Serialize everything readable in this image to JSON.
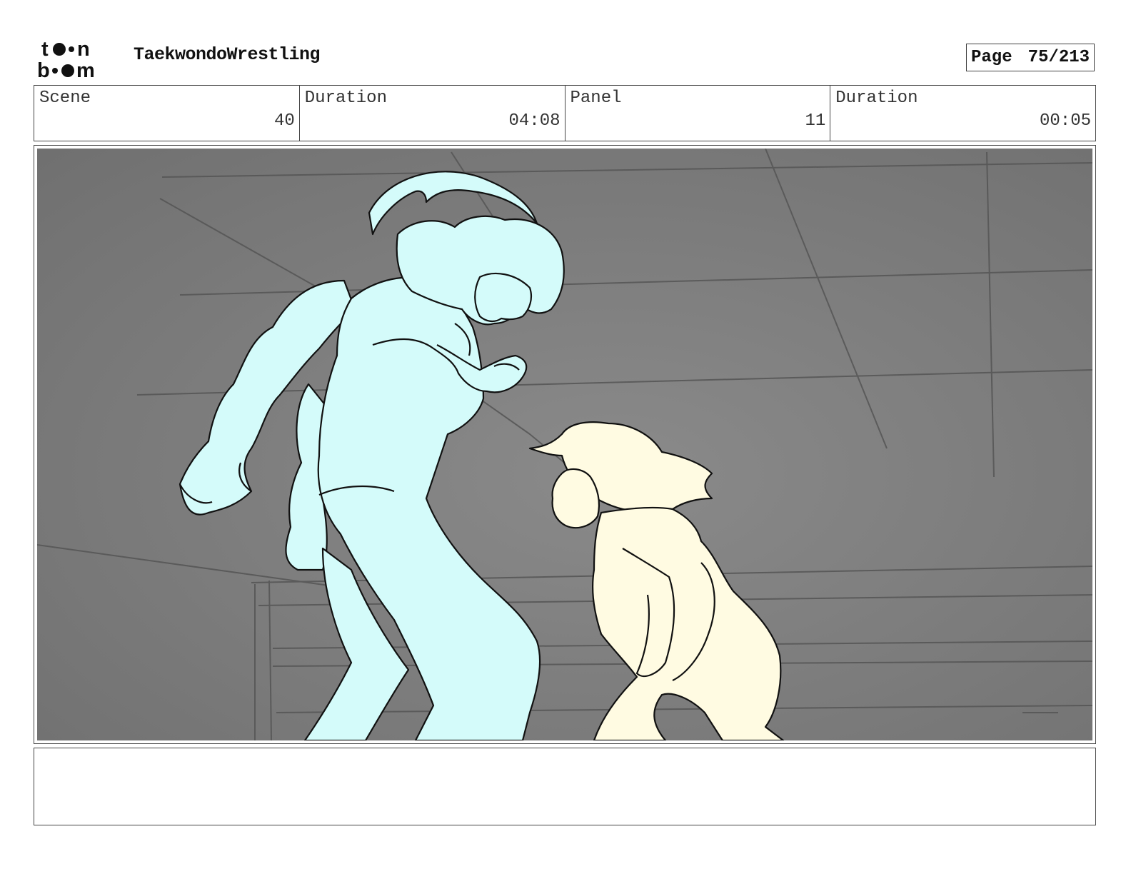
{
  "header": {
    "logo_text": "toon boom",
    "project_title": "TaekwondoWrestling",
    "page_label": "Page",
    "page_number": "75/213"
  },
  "info": {
    "scene_label": "Scene",
    "scene_value": "40",
    "scene_duration_label": "Duration",
    "scene_duration_value": "04:08",
    "panel_label": "Panel",
    "panel_value": "11",
    "panel_duration_label": "Duration",
    "panel_duration_value": "00:05"
  },
  "panel": {
    "background_color": "#7b7b7b",
    "character_left_color": "#d4fbfa",
    "character_right_color": "#fffbe2"
  },
  "notes": {
    "text": ""
  }
}
